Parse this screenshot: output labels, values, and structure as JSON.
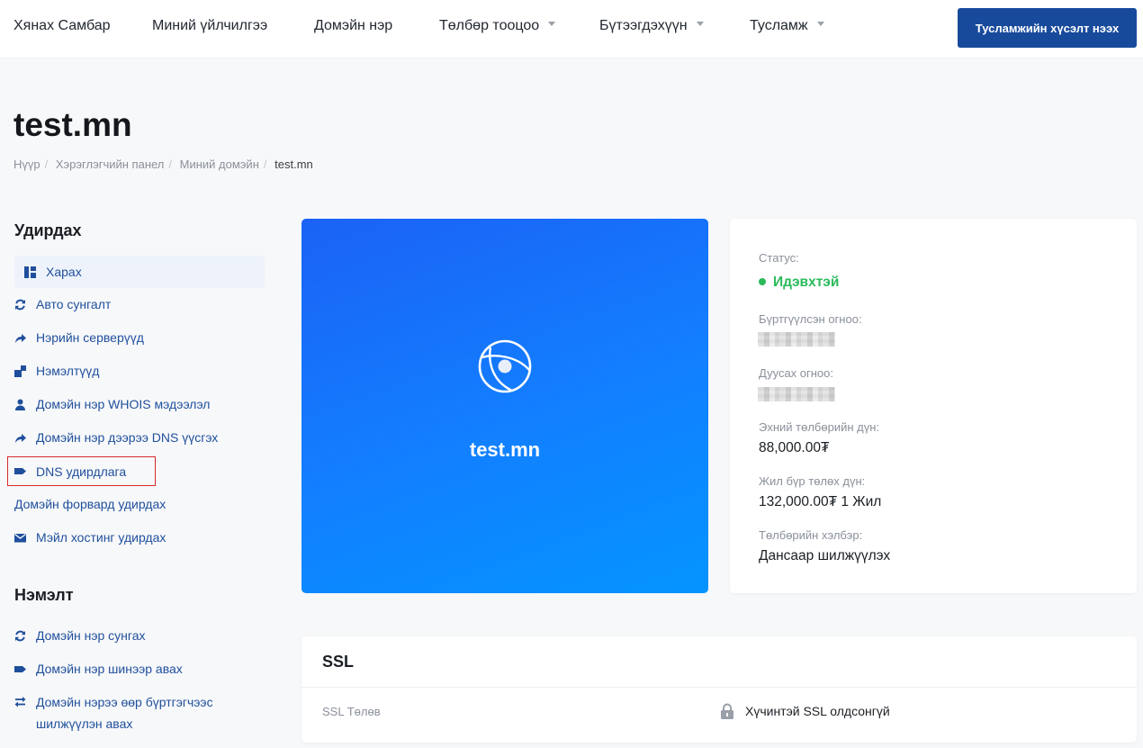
{
  "nav": {
    "items": [
      {
        "label": "Хянах Самбар",
        "dropdown": false
      },
      {
        "label": "Миний үйлчилгээ",
        "dropdown": false
      },
      {
        "label": "Домэйн нэр",
        "dropdown": false
      },
      {
        "label": "Төлбөр тооцоо",
        "dropdown": true
      },
      {
        "label": "Бүтээгдэхүүн",
        "dropdown": true
      },
      {
        "label": "Тусламж",
        "dropdown": true
      }
    ],
    "cta_label": "Тусламжийн хүсэлт нээх"
  },
  "page": {
    "title": "test.mn",
    "breadcrumb": [
      "Нүүр",
      "Хэрэглэгчийн панел",
      "Миний домэйн",
      "test.mn"
    ]
  },
  "sidebar": {
    "manage_heading": "Удирдах",
    "manage_items": [
      {
        "label": "Харах",
        "icon": "dashboard-icon"
      },
      {
        "label": "Авто сунгалт",
        "icon": "refresh-icon"
      },
      {
        "label": "Нэрийн серверүүд",
        "icon": "share-arrow-icon"
      },
      {
        "label": "Нэмэлтүүд",
        "icon": "blocks-icon"
      },
      {
        "label": "Домэйн нэр WHOIS мэдээлэл",
        "icon": "user-icon"
      },
      {
        "label": "Домэйн нэр дээрээ DNS үүсгэх",
        "icon": "share-arrow-icon"
      },
      {
        "label": "DNS удирдлага",
        "icon": "tag-icon"
      },
      {
        "label": "Домэйн форвард удирдах",
        "icon": ""
      },
      {
        "label": "Мэйл хостинг удирдах",
        "icon": "envelope-icon"
      }
    ],
    "extra_heading": "Нэмэлт",
    "extra_items": [
      {
        "label": "Домэйн нэр сунгах",
        "icon": "refresh-icon"
      },
      {
        "label": "Домэйн нэр шинээр авах",
        "icon": "tag-icon"
      },
      {
        "label": "Домэйн нэрээ өөр бүртгэгчээс шилжүүлэн авах",
        "icon": "transfer-icon"
      }
    ]
  },
  "domain_card": {
    "name": "test.mn",
    "icon": "globe-icon"
  },
  "info": {
    "status_label": "Статус:",
    "status_value": "Идэвхтэй",
    "status_color": "#2aba5a",
    "registered_label": "Бүртгүүлсэн огноо:",
    "expiry_label": "Дуусах огноо:",
    "first_payment_label": "Эхний төлбөрийн дүн:",
    "first_payment_value": "88,000.00₮",
    "recurring_label": "Жил бүр төлөх дүн:",
    "recurring_value": "132,000.00₮ 1 Жил",
    "payment_method_label": "Төлбөрийн хэлбэр:",
    "payment_method_value": "Дансаар шилжүүлэх"
  },
  "ssl": {
    "title": "SSL",
    "status_label": "SSL Төлөв",
    "status_value": "Хүчинтэй SSL олдсонгүй",
    "icon": "lock-icon"
  },
  "colors": {
    "primary": "#174a9b",
    "link": "#1f4f9c",
    "highlight_border": "#d62a2a"
  }
}
